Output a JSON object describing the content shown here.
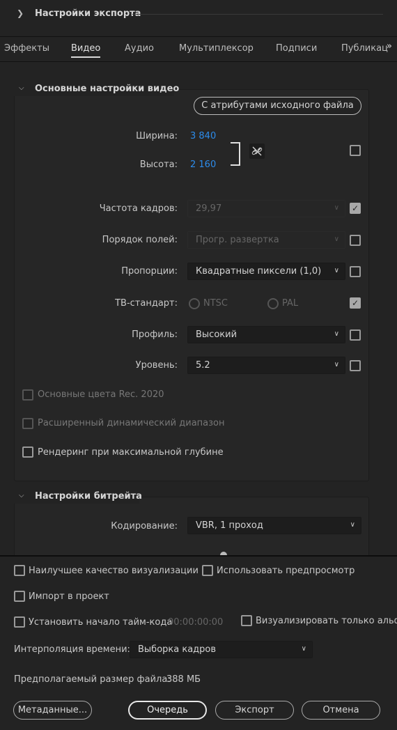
{
  "header": {
    "title": "Настройки экспорта"
  },
  "tabs": [
    {
      "label": "Эффекты"
    },
    {
      "label": "Видео"
    },
    {
      "label": "Аудио"
    },
    {
      "label": "Мультиплексор"
    },
    {
      "label": "Подписи"
    },
    {
      "label": "Публикац"
    }
  ],
  "video_basic": {
    "title": "Основные настройки видео",
    "match_source_button": "С атрибутами исходного файла",
    "width_label": "Ширина:",
    "width_value": "3 840",
    "height_label": "Высота:",
    "height_value": "2 160",
    "framerate_label": "Частота кадров:",
    "framerate_value": "29,97",
    "field_order_label": "Порядок полей:",
    "field_order_value": "Прогр. развертка",
    "aspect_label": "Пропорции:",
    "aspect_value": "Квадратные пиксели (1,0)",
    "tv_standard_label": "ТВ-стандарт:",
    "tv_ntsc": "NTSC",
    "tv_pal": "PAL",
    "profile_label": "Профиль:",
    "profile_value": "Высокий",
    "level_label": "Уровень:",
    "level_value": "5.2",
    "rec2020_label": "Основные цвета Rec. 2020",
    "hdr_label": "Расширенный динамический диапазон",
    "max_depth_label": "Рендеринг при максимальной глубине"
  },
  "bitrate": {
    "title": "Настройки битрейта",
    "encoding_label": "Кодирование:",
    "encoding_value": "VBR, 1 проход"
  },
  "bottom": {
    "best_quality": "Наилучшее качество визуализации",
    "use_preview": "Использовать предпросмотр",
    "import_project": "Импорт в проект",
    "set_timecode": "Установить начало тайм-кода",
    "timecode_value": "00:00:00:00",
    "alpha_only": "Визуализировать только альфа-",
    "time_interp_label": "Интерполяция времени:",
    "time_interp_value": "Выборка кадров",
    "filesize_label": "Предполагаемый размер файла:",
    "filesize_value": "388 МБ",
    "metadata_button": "Метаданные...",
    "queue_button": "Очередь",
    "export_button": "Экспорт",
    "cancel_button": "Отмена"
  }
}
